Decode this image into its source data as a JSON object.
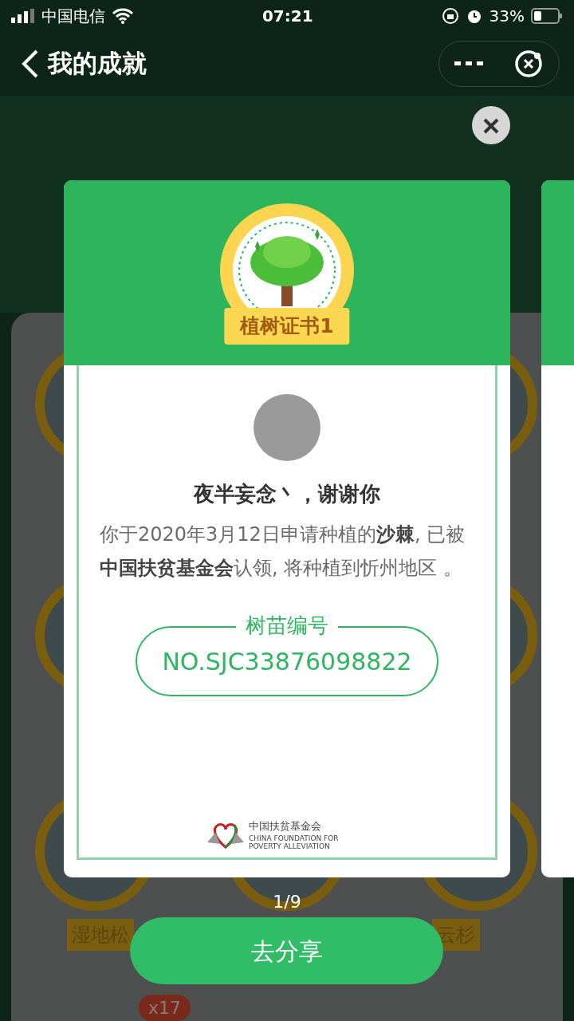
{
  "status_bar": {
    "carrier": "中国电信",
    "time": "07:21",
    "battery": "33%"
  },
  "header": {
    "title": "我的成就"
  },
  "background": {
    "badges": [
      {
        "label": "湿地松"
      },
      {
        "label": "云杉"
      }
    ],
    "count": "x17"
  },
  "certificate": {
    "title": "植树证书1",
    "greeting": "夜半妄念丶，谢谢你",
    "message": "你于2020年3月12日申请种植的**沙棘**, 已被**中国扶贫基金会**认领, 将种植到忻州地区 。",
    "seedling_label": "树苗编号",
    "seedling_number": "NO.SJC33876098822",
    "logo_name": "中国扶贫基金会",
    "logo_english": "CHINA FOUNDATION FOR POVERTY ALLEVIATION"
  },
  "pager": "1/9",
  "share_button": "去分享"
}
